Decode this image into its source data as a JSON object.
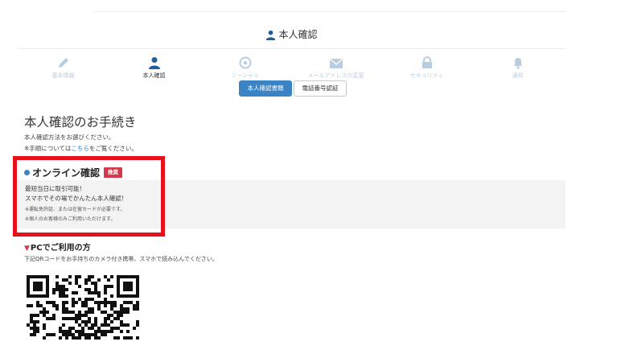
{
  "header": {
    "title": "本人確認",
    "icon": "person-icon"
  },
  "tabs": [
    {
      "label": "基本情報",
      "icon": "pencil-icon",
      "active": false
    },
    {
      "label": "本人確認",
      "icon": "person-icon",
      "active": true
    },
    {
      "label": "ソーシャル",
      "icon": "social-icon",
      "active": false
    },
    {
      "label": "メールアドレスの変更",
      "icon": "mail-icon",
      "active": false
    },
    {
      "label": "セキュリティ",
      "icon": "lock-icon",
      "active": false
    },
    {
      "label": "通知",
      "icon": "bell-icon",
      "active": false
    }
  ],
  "subtabs": {
    "primary": "本人確認書類",
    "secondary": "電話番号認証"
  },
  "page_title": "本人確認のお手続き",
  "intro": {
    "line1": "本人確認方法をお選びください。",
    "line2_prefix": "※手順については",
    "line2_link": "こちら",
    "line2_suffix": "をご覧ください。"
  },
  "online": {
    "title": "オンライン確認",
    "badge": "推奨",
    "line1": "最短当日に取引可能！",
    "line2": "スマホでその場でかんたん本人確認！",
    "note1": "※運転免許証、または在留カードが必要です。",
    "note2": "※個人のお客様のみご利用いただけます。"
  },
  "pc": {
    "title": "PCでご利用の方",
    "marker": "▼",
    "desc": "下記QRコードをお手持ちのカメラ付き携帯、スマホで読み込んでください。"
  },
  "colors": {
    "accent": "#3a83c4",
    "badge": "#d33a4a",
    "highlight": "#e8101a",
    "inactive_tab": "#b8cde0"
  }
}
